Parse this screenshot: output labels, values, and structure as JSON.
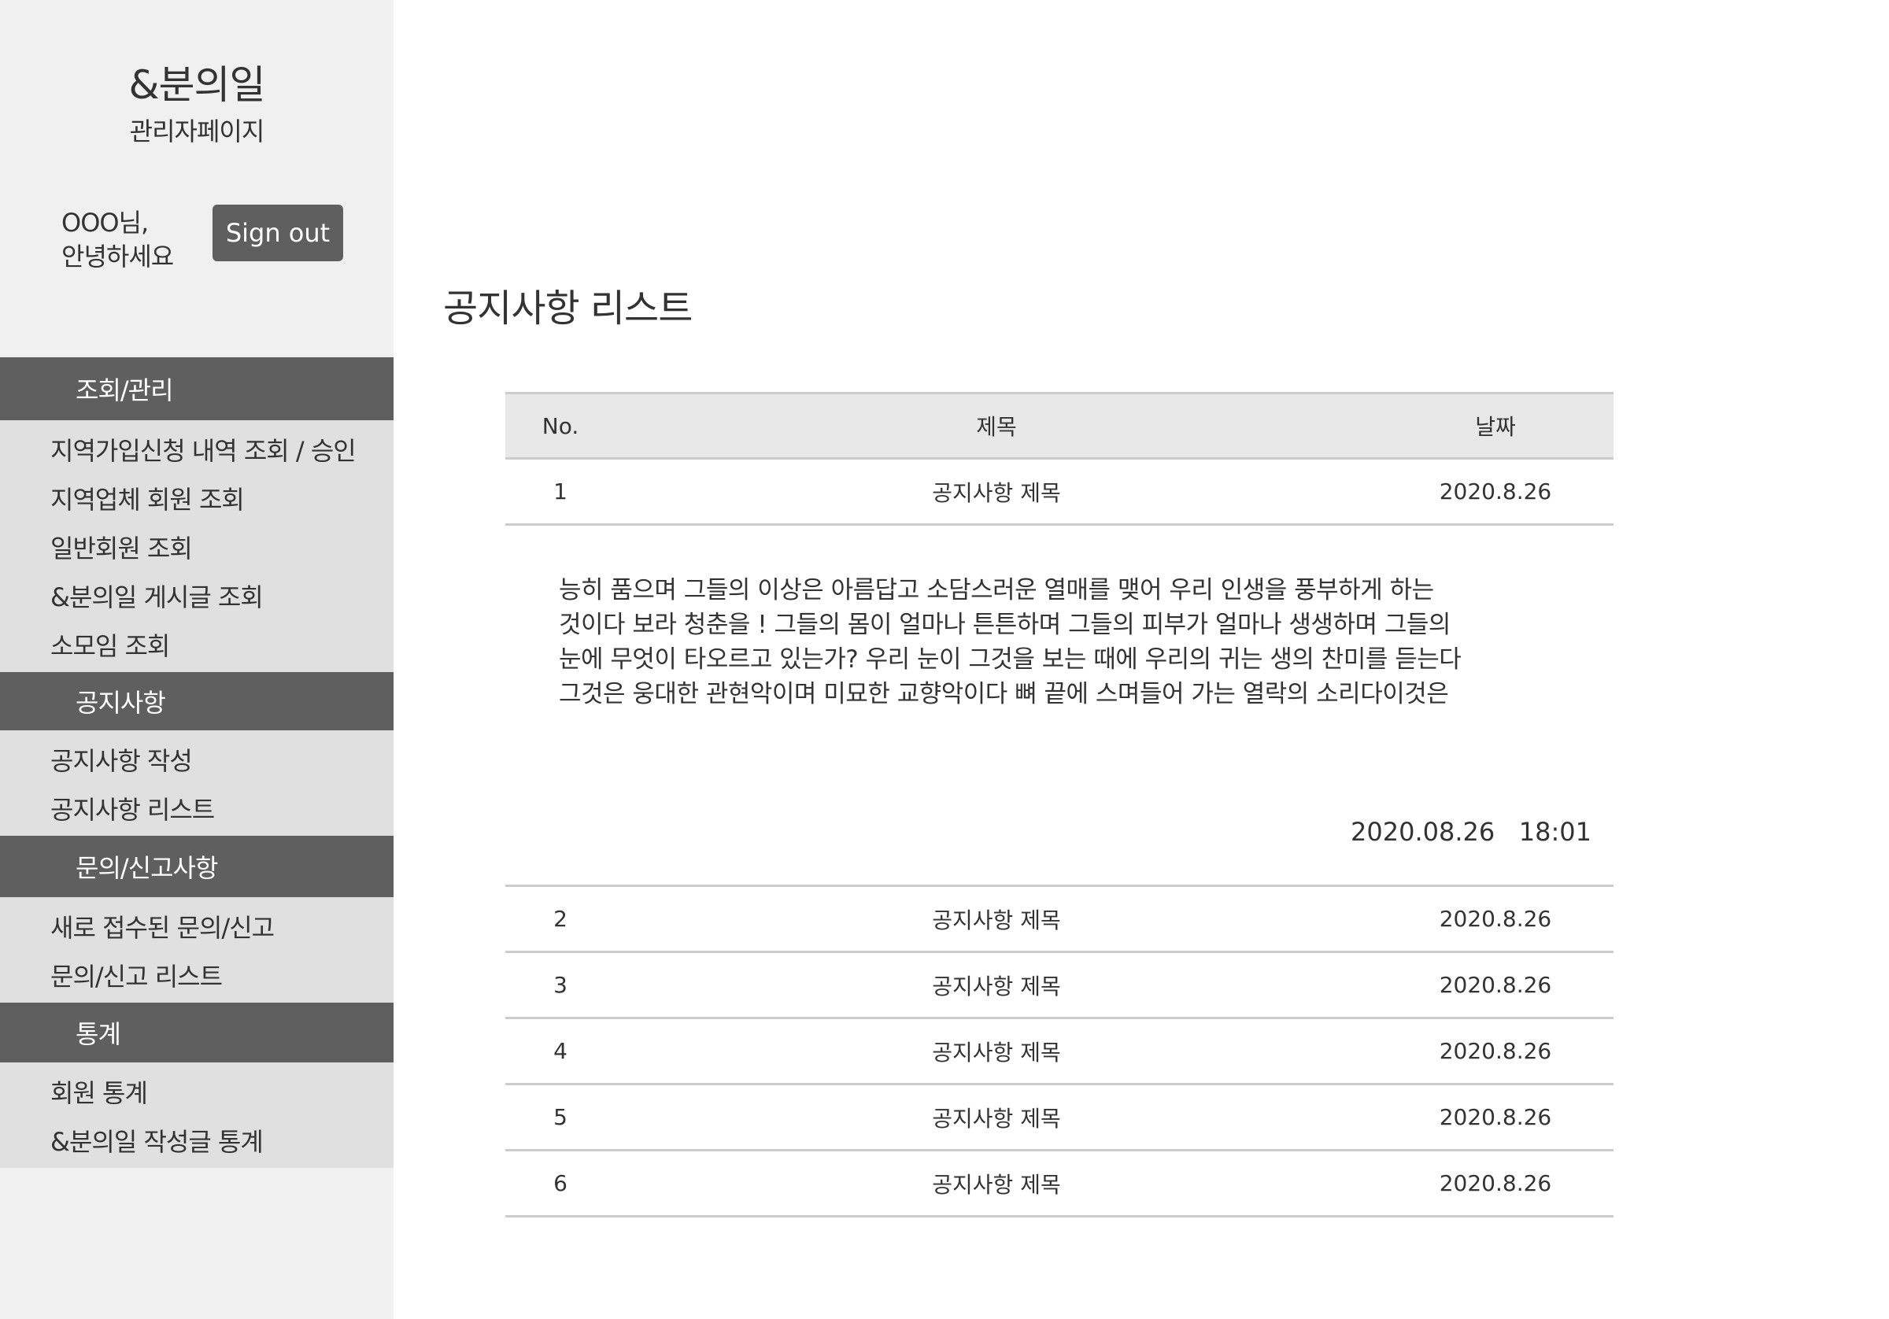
{
  "sidebar": {
    "brand": "&분의일",
    "brand_sub": "관리자페이지",
    "greeting_line1": "OOO님,",
    "greeting_line2": "안녕하세요",
    "signout_label": "Sign out",
    "sections": [
      {
        "title": "조회/관리",
        "items": [
          "지역가입신청 내역 조회 / 승인",
          "지역업체 회원 조회",
          "일반회원 조회",
          "&분의일 게시글 조회",
          "소모임 조회"
        ]
      },
      {
        "title": "공지사항",
        "items": [
          "공지사항 작성",
          "공지사항 리스트"
        ]
      },
      {
        "title": "문의/신고사항",
        "items": [
          "새로 접수된 문의/신고",
          "문의/신고 리스트"
        ]
      },
      {
        "title": "통계",
        "items": [
          "회원 통계",
          "&분의일 작성글 통계"
        ]
      }
    ]
  },
  "main": {
    "title": "공지사항 리스트",
    "table": {
      "headers": {
        "no": "No.",
        "title": "제목",
        "date": "날짜"
      },
      "rows": [
        {
          "no": "1",
          "title": "공지사항 제목",
          "date": "2020.8.26"
        },
        {
          "no": "2",
          "title": "공지사항 제목",
          "date": "2020.8.26"
        },
        {
          "no": "3",
          "title": "공지사항 제목",
          "date": "2020.8.26"
        },
        {
          "no": "4",
          "title": "공지사항 제목",
          "date": "2020.8.26"
        },
        {
          "no": "5",
          "title": "공지사항 제목",
          "date": "2020.8.26"
        },
        {
          "no": "6",
          "title": "공지사항 제목",
          "date": "2020.8.26"
        }
      ],
      "expanded": {
        "row_no": "1",
        "body": "능히 품으며 그들의 이상은 아름답고 소담스러운 열매를 맺어 우리 인생을 풍부하게 하는 것이다 보라 청춘을 ! 그들의 몸이 얼마나 튼튼하며 그들의 피부가 얼마나 생생하며 그들의 눈에 무엇이 타오르고 있는가? 우리 눈이 그것을 보는 때에 우리의 귀는 생의 찬미를 듣는다 그것은 웅대한 관현악이며 미묘한 교향악이다 뼈 끝에 스며들어 가는 열락의 소리다이것은",
        "body_lines": [
          "능히 품으며 그들의 이상은 아름답고 소담스러운 열매를 맺어 우리 인생을 풍부하게 하는",
          "것이다 보라 청춘을 ! 그들의 몸이 얼마나 튼튼하며 그들의 피부가 얼마나 생생하며 그들의",
          "눈에 무엇이 타오르고 있는가? 우리 눈이 그것을 보는 때에 우리의 귀는 생의 찬미를 듣는다",
          "그것은 웅대한 관현악이며 미묘한 교향악이다 뼈 끝에 스며들어 가는 열락의 소리다이것은"
        ],
        "timestamp": "2020.08.26   18:01"
      }
    }
  },
  "colors": {
    "sidebar_bg": "#f0f0f0",
    "sidebar_items_bg": "#e0e0e0",
    "section_header_bg": "#5f5f5f",
    "button_bg": "#5f5f5f",
    "table_header_bg": "#e8e8e8",
    "divider": "#cccccc",
    "text": "#333333"
  }
}
